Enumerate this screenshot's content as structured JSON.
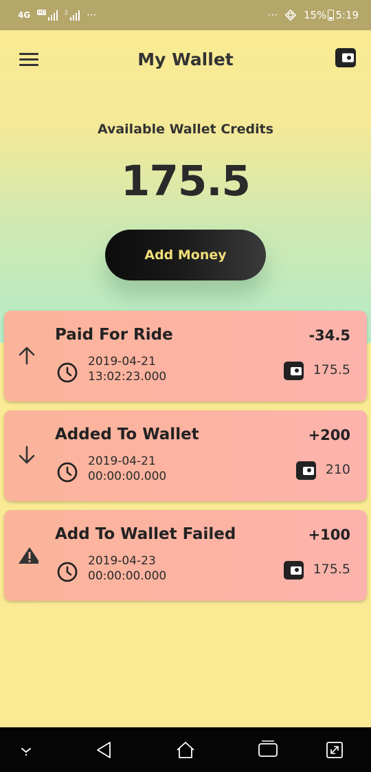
{
  "status_bar": {
    "network": "4G",
    "sim_badge": "HD",
    "sim2_num": "2",
    "more": "···",
    "battery_text": "15%",
    "time": "5:19"
  },
  "header": {
    "title": "My Wallet",
    "menu_icon": "hamburger-menu-icon",
    "wallet_icon": "wallet-icon"
  },
  "wallet": {
    "credits_label": "Available Wallet Credits",
    "credits_value": "175.5",
    "add_money_label": "Add Money"
  },
  "transactions": [
    {
      "title": "Paid For Ride",
      "amount": "-34.5",
      "date": "2019-04-21",
      "time": "13:02:23.000",
      "balance": "175.5",
      "icon": "arrow-up-icon"
    },
    {
      "title": "Added To Wallet",
      "amount": "+200",
      "date": "2019-04-21",
      "time": "00:00:00.000",
      "balance": "210",
      "icon": "arrow-down-icon"
    },
    {
      "title": "Add To Wallet Failed",
      "amount": "+100",
      "date": "2019-04-23",
      "time": "00:00:00.000",
      "balance": "175.5",
      "icon": "warning-icon"
    }
  ],
  "colors": {
    "background": "#faea94",
    "card": "#fcb3a3",
    "button": "#111111",
    "button_text": "#f1de79"
  },
  "nav_bar": {
    "icons": [
      "chevron-down-icon",
      "back-icon",
      "home-icon",
      "recents-icon",
      "screenshot-icon"
    ]
  }
}
